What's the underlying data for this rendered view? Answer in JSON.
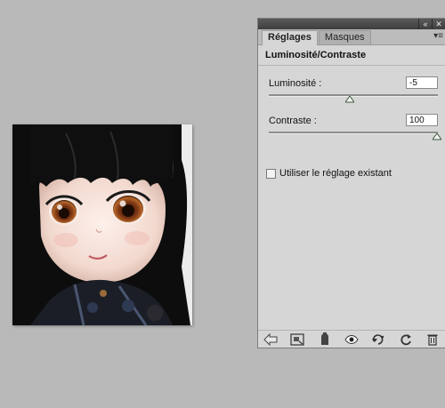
{
  "panel": {
    "tabs": [
      {
        "label": "Réglages",
        "active": true
      },
      {
        "label": "Masques",
        "active": false
      }
    ],
    "title": "Luminosité/Contraste",
    "controls": [
      {
        "label": "Luminosité :",
        "value": "-5",
        "slider_fraction": 0.48
      },
      {
        "label": "Contraste :",
        "value": "100",
        "slider_fraction": 1.0
      }
    ],
    "checkbox": {
      "label": "Utiliser le réglage existant",
      "checked": false
    },
    "footer_icons": [
      "back-arrow-icon",
      "expand-view-icon",
      "clip-to-layer-icon",
      "visibility-eye-icon",
      "previous-state-icon",
      "reset-icon",
      "trash-icon"
    ]
  },
  "colors": {
    "desktop_bg": "#b9b9b9",
    "panel_bg": "#d6d6d6"
  }
}
